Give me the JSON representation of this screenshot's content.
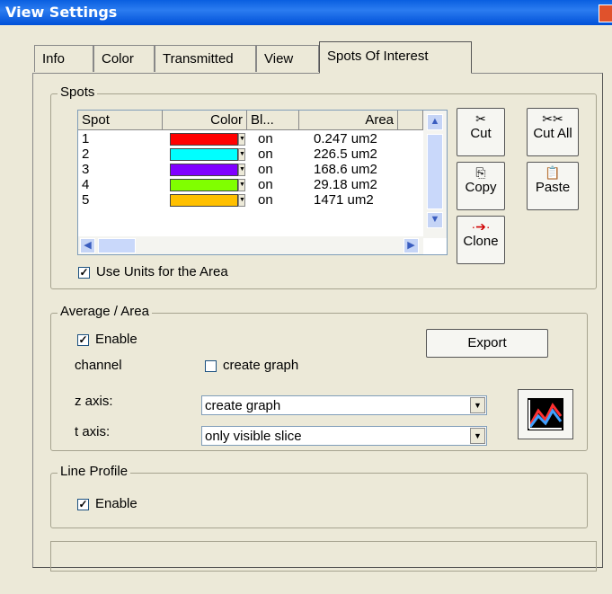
{
  "window": {
    "title": "View Settings"
  },
  "tabs": [
    "Info",
    "Color",
    "Transmitted",
    "View",
    "Spots Of Interest"
  ],
  "spots": {
    "group_label": "Spots",
    "columns": [
      "Spot",
      "Color",
      "Bl...",
      "Area"
    ],
    "rows": [
      {
        "spot": "1",
        "color": "#ff0000",
        "blink": "on",
        "area": "0.247 um2"
      },
      {
        "spot": "2",
        "color": "#00ffff",
        "blink": "on",
        "area": "226.5 um2"
      },
      {
        "spot": "3",
        "color": "#8000ff",
        "blink": "on",
        "area": "168.6 um2"
      },
      {
        "spot": "4",
        "color": "#80ff00",
        "blink": "on",
        "area": "29.18 um2"
      },
      {
        "spot": "5",
        "color": "#ffc000",
        "blink": "on",
        "area": "1471 um2"
      }
    ],
    "use_units_label": "Use Units for the Area",
    "use_units_checked": true,
    "buttons": {
      "cut": "Cut",
      "cut_all": "Cut All",
      "copy": "Copy",
      "paste": "Paste",
      "clone": "Clone"
    }
  },
  "average": {
    "group_label": "Average / Area",
    "enable_label": "Enable",
    "enable_checked": true,
    "export_label": "Export",
    "channel_label": "channel",
    "create_graph_label": "create graph",
    "create_graph_checked": false,
    "z_axis_label": "z axis:",
    "z_axis_value": "create graph",
    "t_axis_label": "t axis:",
    "t_axis_value": "only visible slice"
  },
  "line_profile": {
    "group_label": "Line Profile",
    "enable_label": "Enable",
    "enable_checked": true
  }
}
